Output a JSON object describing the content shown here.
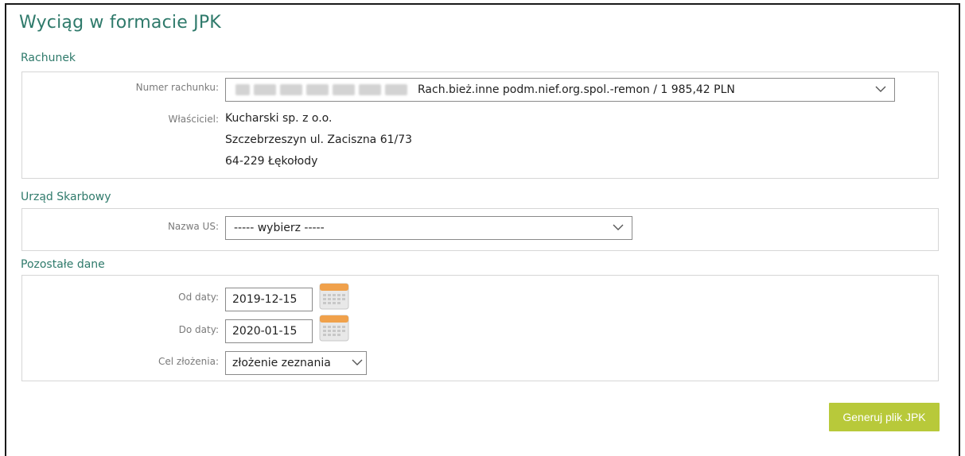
{
  "page": {
    "title": "Wyciąg w formacie JPK"
  },
  "rachunek": {
    "section_title": "Rachunek",
    "account_label": "Numer rachunku:",
    "account_selected": "Rach.bież.inne podm.nief.org.spol.-remon / 1 985,42 PLN",
    "owner_label": "Właściciel:",
    "owner_lines": [
      "Kucharski sp. z o.o.",
      "Szczebrzeszyn ul. Zaciszna 61/73",
      "64-229 Łękołody"
    ]
  },
  "urzad": {
    "section_title": "Urząd Skarbowy",
    "us_label": "Nazwa US:",
    "us_selected": "----- wybierz -----"
  },
  "pozostale": {
    "section_title": "Pozostałe dane",
    "from_label": "Od daty:",
    "from_value": "2019-12-15",
    "to_label": "Do daty:",
    "to_value": "2020-01-15",
    "purpose_label": "Cel złożenia:",
    "purpose_selected": "złożenie zeznania"
  },
  "actions": {
    "generate_label": "Generuj plik JPK"
  },
  "icons": {
    "dropdown": "chevron-down-icon",
    "calendar": "calendar-icon"
  },
  "colors": {
    "accent_text": "#2f7a6b",
    "button": "#b8c93a",
    "calendar_top": "#f0a14b"
  }
}
